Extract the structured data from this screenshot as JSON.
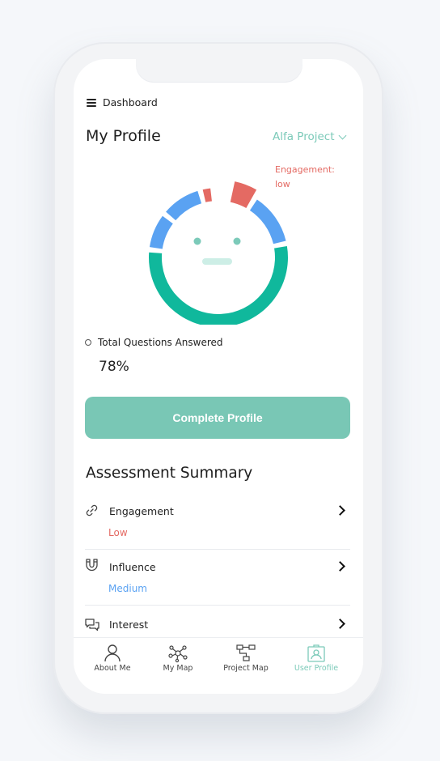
{
  "header": {
    "menu_label": "Dashboard"
  },
  "profile": {
    "title": "My Profile",
    "project": "Alfa Project"
  },
  "chart": {
    "engagement_callout_line1": "Engagement:",
    "engagement_callout_line2": "low",
    "segments": [
      {
        "name": "engagement",
        "fraction": 0.06,
        "color": "#e46a63",
        "state": "highlighted"
      },
      {
        "name": "influence",
        "fraction": 0.13,
        "color": "#5aa2f2"
      },
      {
        "name": "interest",
        "fraction": 0.55,
        "color": "#10b89c"
      },
      {
        "name": "segment-4",
        "fraction": 0.09,
        "color": "#5aa2f2"
      },
      {
        "name": "segment-5",
        "fraction": 0.1,
        "color": "#5aa2f2"
      },
      {
        "name": "segment-6",
        "fraction": 0.03,
        "color": "#e46a63"
      }
    ],
    "face_color": "#7ccab9"
  },
  "progress": {
    "label": "Total Questions Answered",
    "value": "78%"
  },
  "actions": {
    "complete_profile": "Complete Profile"
  },
  "summary": {
    "title": "Assessment Summary",
    "items": [
      {
        "label": "Engagement",
        "status": "Low",
        "status_color": "#e46a63",
        "icon": "link-icon"
      },
      {
        "label": "Influence",
        "status": "Medium",
        "status_color": "#5aa2f2",
        "icon": "magnet-icon"
      },
      {
        "label": "Interest",
        "status": "",
        "status_color": "#222222",
        "icon": "chat-bubbles-icon"
      }
    ]
  },
  "nav": {
    "items": [
      {
        "label": "About Me",
        "icon": "user-icon",
        "active": false
      },
      {
        "label": "My Map",
        "icon": "network-icon",
        "active": false
      },
      {
        "label": "Project Map",
        "icon": "flowchart-icon",
        "active": false
      },
      {
        "label": "User Profile",
        "icon": "id-card-icon",
        "active": true
      }
    ]
  },
  "colors": {
    "accent": "#7ccab9",
    "button": "#79c7b5",
    "low": "#e46a63",
    "medium": "#5aa2f2",
    "green": "#10b89c"
  }
}
